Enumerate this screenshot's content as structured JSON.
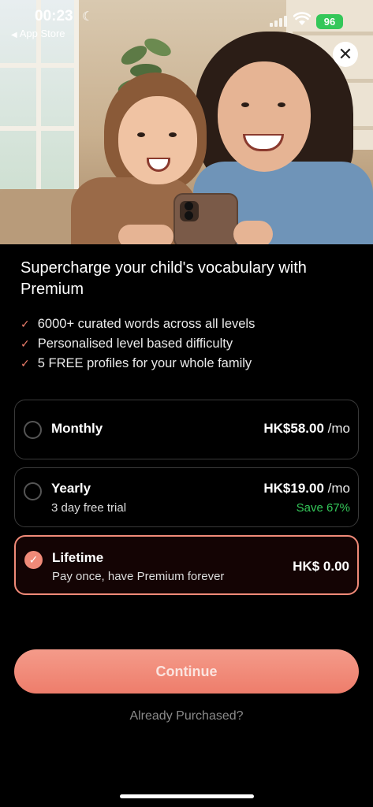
{
  "status_bar": {
    "time": "00:23",
    "moon_glyph": "☾",
    "back_label": "App Store",
    "battery": "96"
  },
  "close_glyph": "✕",
  "headline": "Supercharge your child's vocabulary with Premium",
  "features": [
    "6000+ curated words across all levels",
    "Personalised level based difficulty",
    "5 FREE profiles for your whole family"
  ],
  "check_glyph": "✓",
  "plans": [
    {
      "name": "Monthly",
      "subtitle": "",
      "price": "HK$58.00",
      "period": " /mo",
      "save": "",
      "selected": false
    },
    {
      "name": "Yearly",
      "subtitle": "3 day free trial",
      "price": "HK$19.00",
      "period": " /mo",
      "save": "Save 67%",
      "selected": false
    },
    {
      "name": "Lifetime",
      "subtitle": "Pay once, have Premium forever",
      "price": "HK$ 0.00",
      "period": "",
      "save": "",
      "selected": true
    }
  ],
  "cta_label": "Continue",
  "restore_label": "Already Purchased?",
  "colors": {
    "accent": "#f08a78",
    "save_green": "#34c759",
    "battery_green": "#34c759"
  }
}
